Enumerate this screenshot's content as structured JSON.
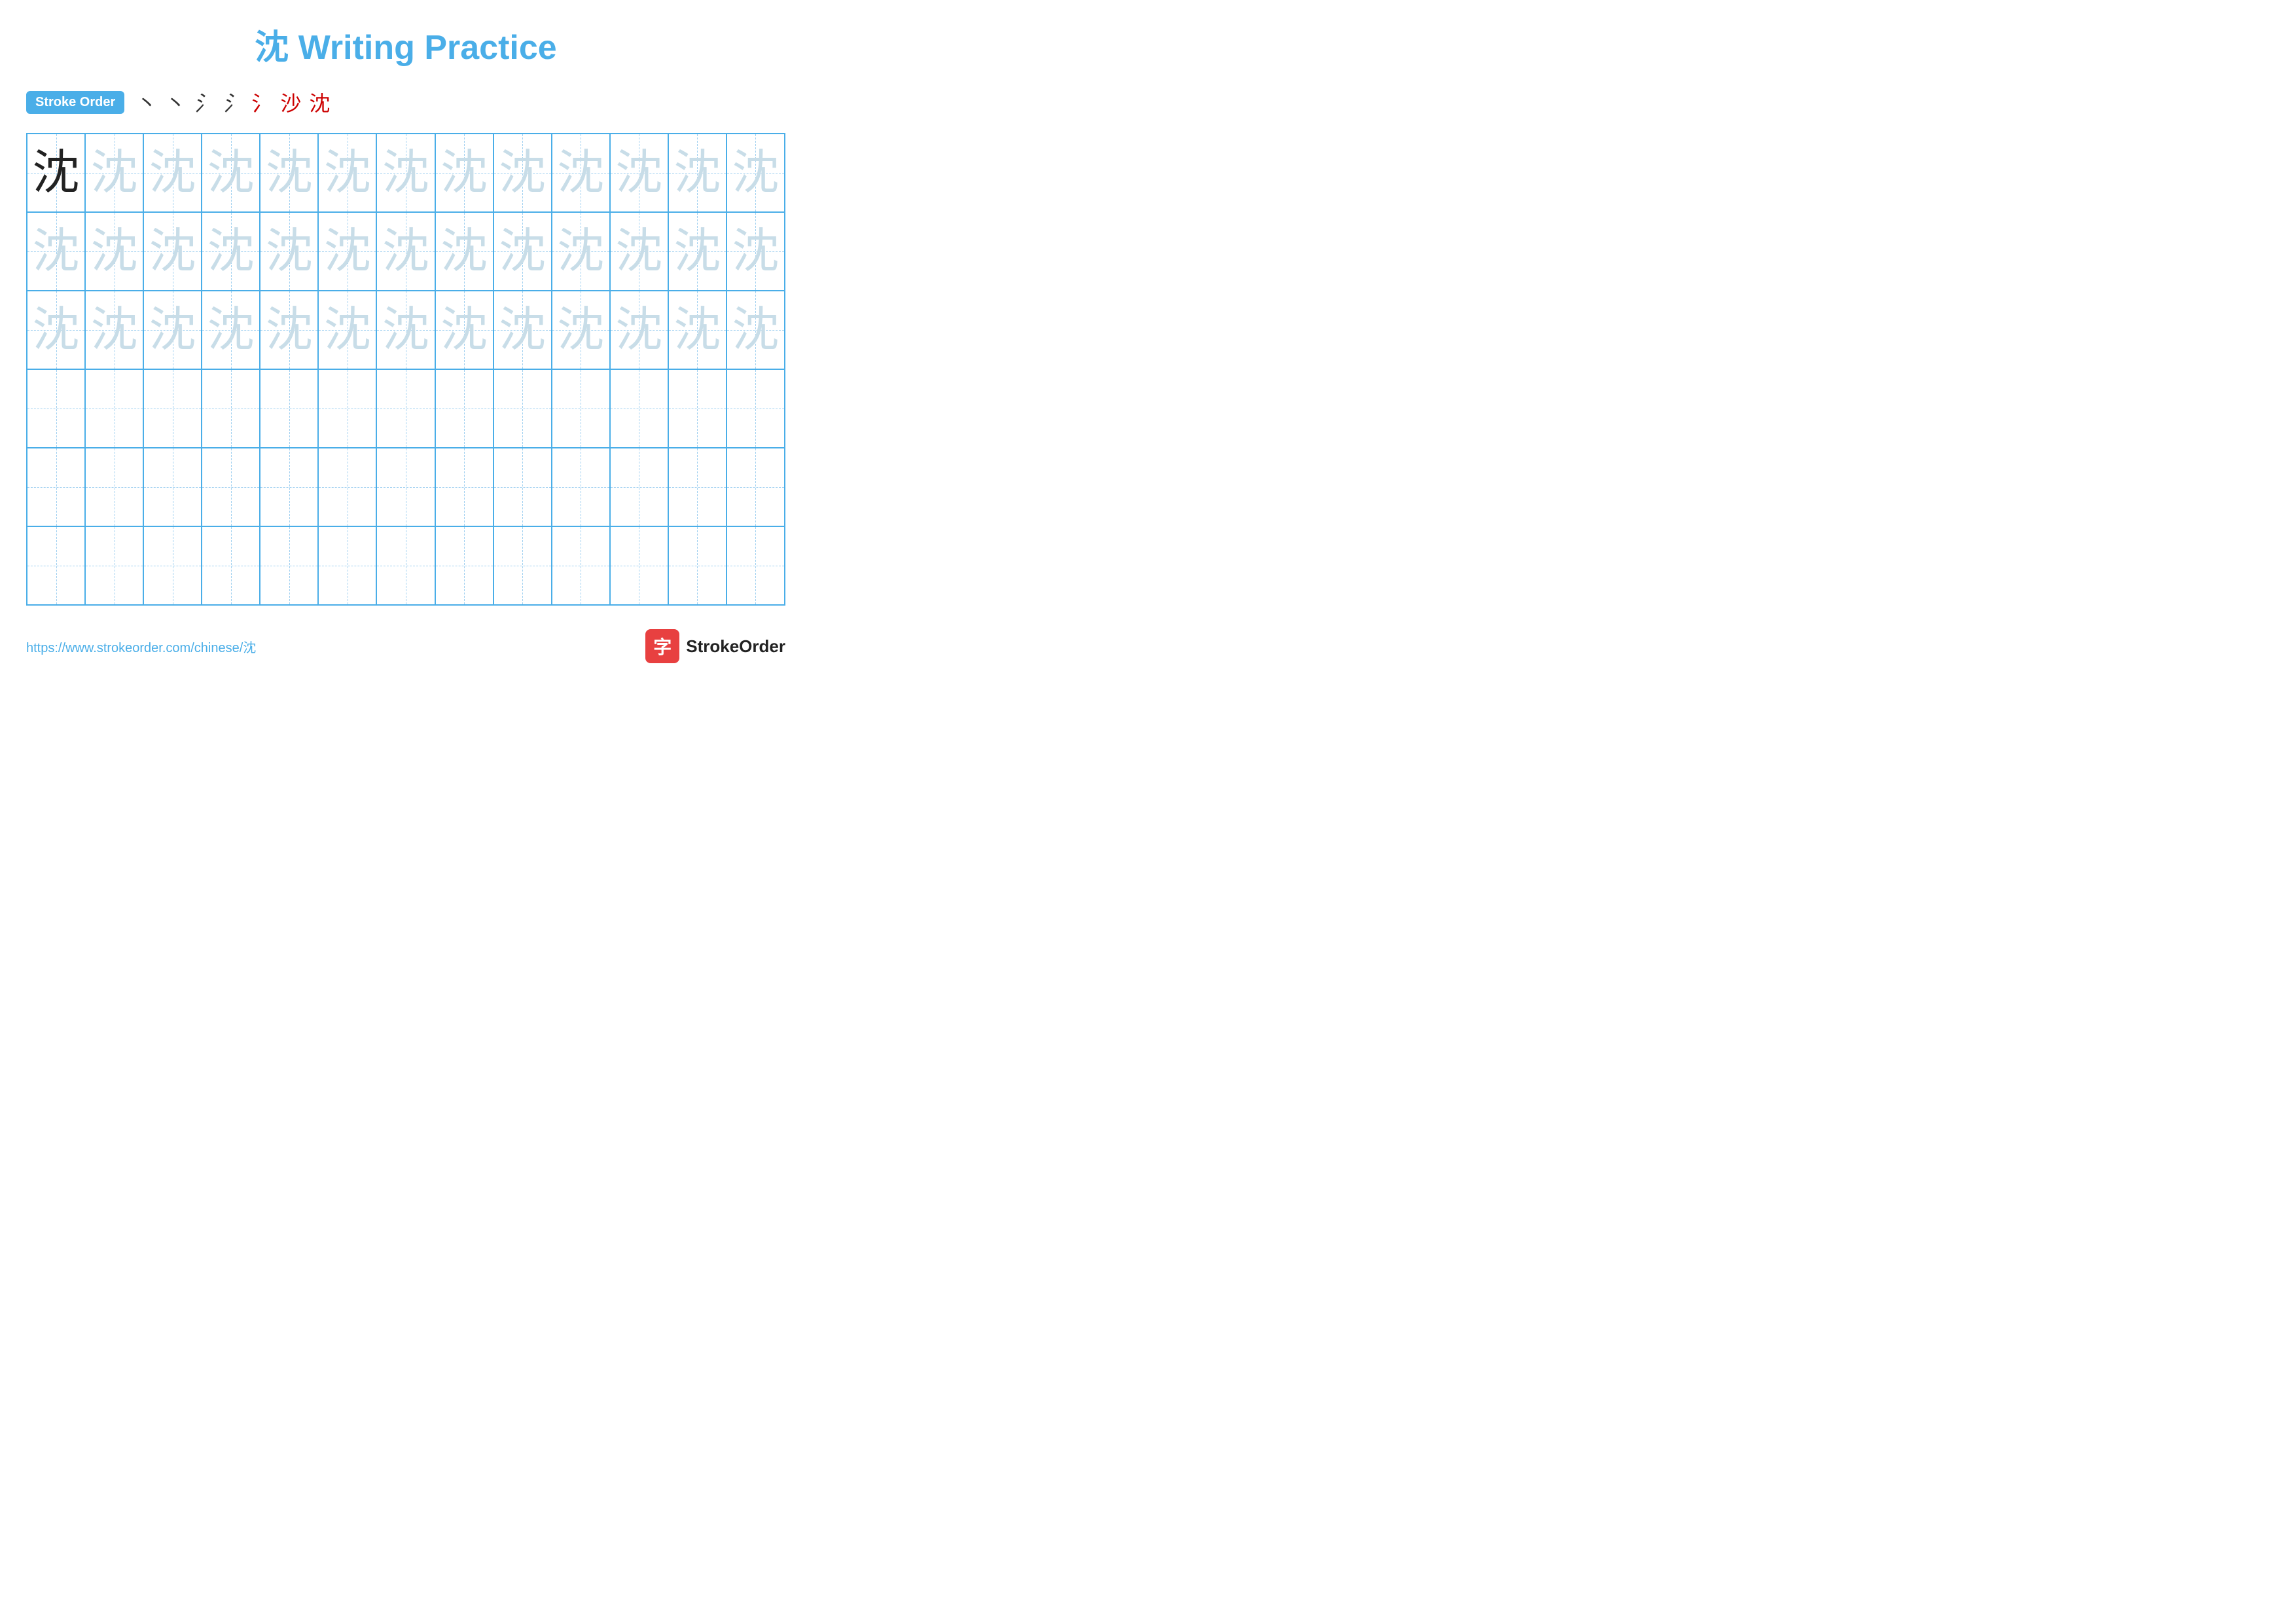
{
  "page": {
    "title": "沈 Writing Practice",
    "title_char": "沈",
    "title_rest": " Writing Practice"
  },
  "stroke_order": {
    "badge_label": "Stroke Order",
    "strokes": [
      "丶",
      "丶",
      "㇀",
      "㇀",
      "氵",
      "沙",
      "沈"
    ]
  },
  "grid": {
    "cols": 13,
    "rows": 6,
    "char": "沈",
    "row_types": [
      "dark-first",
      "light",
      "light",
      "empty",
      "empty",
      "empty"
    ]
  },
  "footer": {
    "url": "https://www.strokeorder.com/chinese/沈",
    "brand_icon_char": "字",
    "brand_name": "StrokeOrder"
  }
}
